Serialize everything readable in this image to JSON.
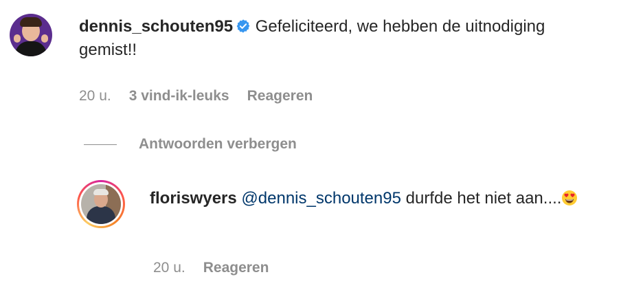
{
  "comments": [
    {
      "username": "dennis_schouten95",
      "verified": true,
      "text": "Gefeliciteerd, we hebben de uitnodiging gemist!!",
      "time": "20 u.",
      "likes": "3 vind-ik-leuks",
      "reply_label": "Reageren",
      "avatar": "profile-photo"
    }
  ],
  "replies_toggle": {
    "label": "Antwoorden verbergen"
  },
  "reply": {
    "username": "floriswyers",
    "mention": "@dennis_schouten95",
    "text_before_emoji": " durfde het niet aan....",
    "emoji": "smiling-face-with-heart-eyes",
    "time": "20 u.",
    "reply_label": "Reageren",
    "avatar": "profile-photo-with-story-ring"
  },
  "colors": {
    "text": "#262626",
    "muted": "#8e8e8e",
    "mention": "#00376b",
    "verified": "#3897f0"
  }
}
